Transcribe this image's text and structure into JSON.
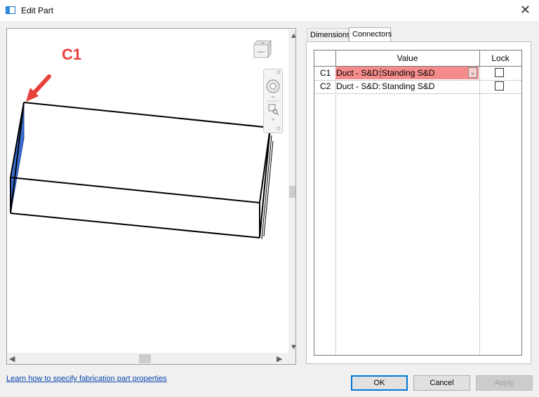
{
  "window": {
    "title": "Edit Part",
    "close_glyph": "✕",
    "app_icon": "window-icon"
  },
  "viewport": {
    "annotation_label": "C1",
    "highlight_color": "#3b6fd6",
    "annotation_color": "#e8403a",
    "viewcube": {
      "top": "TOP",
      "front": "FRONT"
    },
    "scroll": {
      "up": "▲",
      "down": "▼",
      "left": "◀",
      "right": "▶"
    }
  },
  "tabs": [
    {
      "label": "Dimensions",
      "active": false
    },
    {
      "label": "Connectors",
      "active": true
    }
  ],
  "grid": {
    "headers": {
      "value": "Value",
      "lock": "Lock"
    },
    "rows": [
      {
        "id": "C1",
        "value_left": "Duct - S&D:",
        "value_right": "Standing S&D",
        "selected": true,
        "locked": false
      },
      {
        "id": "C2",
        "value_left": "Duct - S&D:",
        "value_right": "Standing S&D",
        "selected": false,
        "locked": false
      }
    ],
    "selection_color": "#f58b8b",
    "dropdown_glyph": "⌄"
  },
  "footer": {
    "help_link": "Learn how to specify fabrication part properties",
    "ok_label": "OK",
    "cancel_label": "Cancel",
    "apply_label": "Apply"
  }
}
